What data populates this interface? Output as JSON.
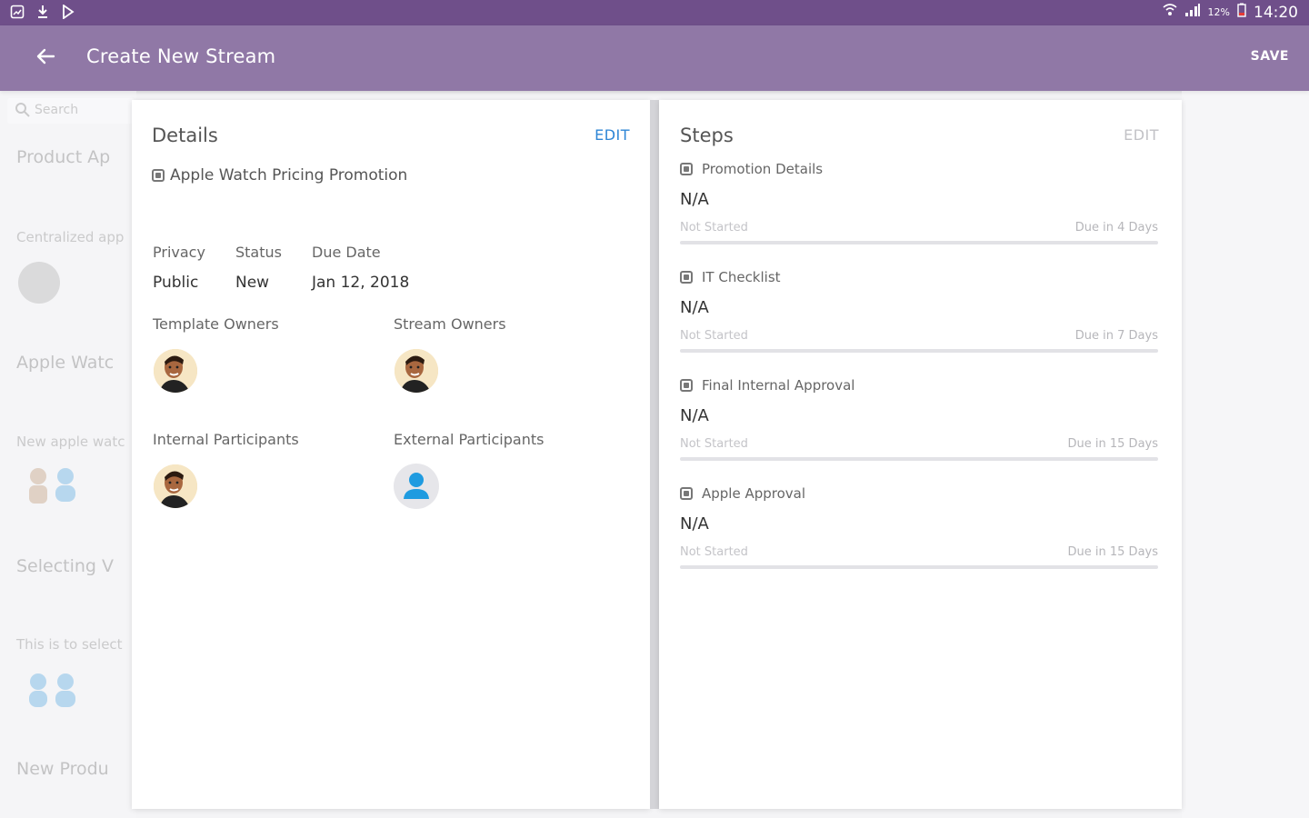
{
  "status_bar": {
    "time": "14:20",
    "battery_pct": "12%"
  },
  "appbar": {
    "title": "Create New Stream",
    "save_label": "SAVE"
  },
  "background_list": {
    "search_placeholder": "Search",
    "items": [
      {
        "title": "Product Ap",
        "desc": "Centralized app"
      },
      {
        "title": "Apple Watc",
        "desc": "New apple watc"
      },
      {
        "title": "Selecting V",
        "desc": "This is to select"
      },
      {
        "title": "New Produ",
        "desc": ""
      }
    ]
  },
  "details": {
    "title": "Details",
    "edit_label": "EDIT",
    "stream_name": "Apple Watch Pricing Promotion",
    "privacy_label": "Privacy",
    "privacy_value": "Public",
    "status_label": "Status",
    "status_value": "New",
    "due_date_label": "Due Date",
    "due_date_value": "Jan 12, 2018",
    "template_owners_label": "Template Owners",
    "stream_owners_label": "Stream Owners",
    "internal_participants_label": "Internal Participants",
    "external_participants_label": "External Participants"
  },
  "steps": {
    "title": "Steps",
    "edit_label": "EDIT",
    "items": [
      {
        "name": "Promotion Details",
        "value": "N/A",
        "status": "Not Started",
        "due": "Due in 4 Days",
        "progress": 0
      },
      {
        "name": "IT Checklist",
        "value": "N/A",
        "status": "Not Started",
        "due": "Due in 7 Days",
        "progress": 0
      },
      {
        "name": "Final Internal Approval",
        "value": "N/A",
        "status": "Not Started",
        "due": "Due in 15 Days",
        "progress": 0
      },
      {
        "name": "Apple Approval",
        "value": "N/A",
        "status": "Not Started",
        "due": "Due in 15 Days",
        "progress": 0
      }
    ]
  },
  "colors": {
    "status_bar": "#6f4f8a",
    "app_bar": "#9078a6",
    "edit_active": "#2e86d6",
    "edit_inactive": "#c2c2c6",
    "person_icon": "#1f9be0"
  }
}
